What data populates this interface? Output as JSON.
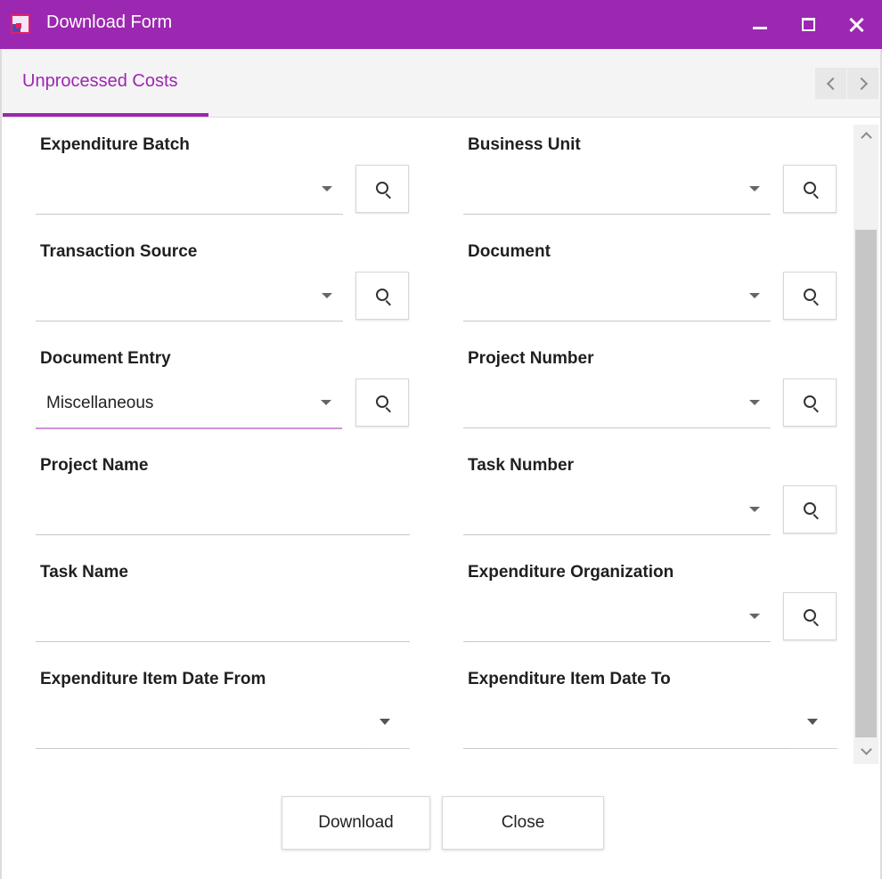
{
  "window": {
    "title": "Download Form",
    "app_icon": "app-logo-icon",
    "controls": [
      "minimize-icon",
      "maximize-icon",
      "close-icon"
    ]
  },
  "tabs": [
    {
      "label": "Unprocessed Costs",
      "active": true
    }
  ],
  "tab_nav": [
    "chevron-left-icon",
    "chevron-right-icon"
  ],
  "form": {
    "expenditure_batch": {
      "label": "Expenditure Batch",
      "value": ""
    },
    "business_unit": {
      "label": "Business Unit",
      "value": ""
    },
    "transaction_source": {
      "label": "Transaction Source",
      "value": ""
    },
    "document": {
      "label": "Document",
      "value": ""
    },
    "document_entry": {
      "label": "Document Entry",
      "value": "Miscellaneous"
    },
    "project_number": {
      "label": "Project Number",
      "value": ""
    },
    "project_name": {
      "label": "Project Name",
      "value": ""
    },
    "task_number": {
      "label": "Task Number",
      "value": ""
    },
    "task_name": {
      "label": "Task Name",
      "value": ""
    },
    "expenditure_organization": {
      "label": "Expenditure Organization",
      "value": ""
    },
    "expenditure_item_date_from": {
      "label": "Expenditure Item Date From",
      "value": ""
    },
    "expenditure_item_date_to": {
      "label": "Expenditure Item Date To",
      "value": ""
    }
  },
  "buttons": {
    "download": "Download",
    "close": "Close"
  },
  "colors": {
    "accent": "#9c27b0",
    "active_underline": "#ce93d8",
    "tab_bar_bg": "#f4f4f4"
  }
}
